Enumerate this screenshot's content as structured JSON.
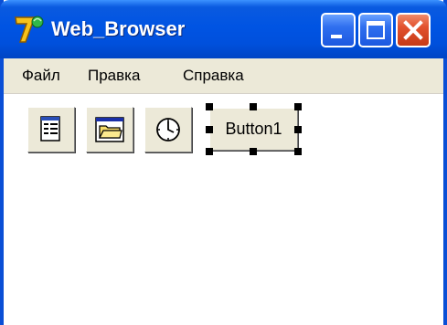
{
  "window": {
    "title": "Web_Browser",
    "app_icon": "delphi-seven-icon",
    "caption_buttons": [
      "minimize-icon",
      "maximize-icon",
      "close-icon"
    ],
    "colors": {
      "titlebar": "#0054e3",
      "close": "#e2522e",
      "frame": "#0a4fd6"
    }
  },
  "menubar": {
    "items": [
      {
        "label": "Файл"
      },
      {
        "label": "Правка"
      },
      {
        "label": "Справка"
      }
    ],
    "background": "#ece9d8"
  },
  "toolbar": {
    "buttons": [
      {
        "icon": "properties-icon"
      },
      {
        "icon": "open-folder-icon"
      },
      {
        "icon": "clock-icon"
      }
    ]
  },
  "form": {
    "button1": {
      "label": "Button1",
      "selected": true
    }
  }
}
